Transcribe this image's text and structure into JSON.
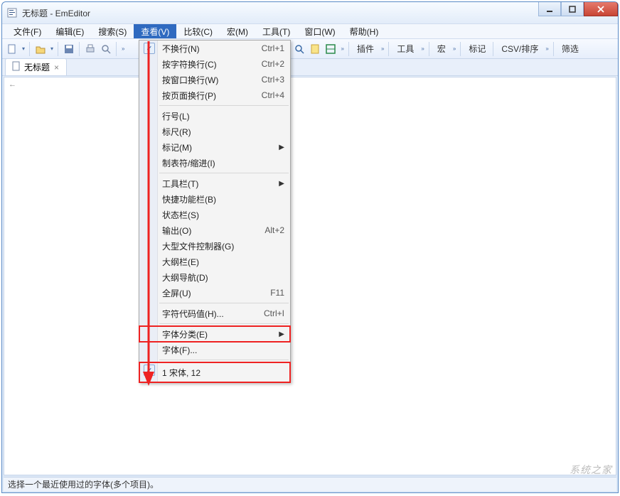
{
  "window": {
    "title": "无标题 - EmEditor"
  },
  "menubar": {
    "items": [
      {
        "label": "文件(F)"
      },
      {
        "label": "编辑(E)"
      },
      {
        "label": "搜索(S)"
      },
      {
        "label": "查看(V)",
        "active": true
      },
      {
        "label": "比较(C)"
      },
      {
        "label": "宏(M)"
      },
      {
        "label": "工具(T)"
      },
      {
        "label": "窗口(W)"
      },
      {
        "label": "帮助(H)"
      }
    ]
  },
  "toolbar": {
    "groups": [
      "插件",
      "工具",
      "宏",
      "标记",
      "CSV/排序",
      "筛选"
    ]
  },
  "tabs": {
    "items": [
      {
        "label": "无标题"
      }
    ]
  },
  "dropdown": {
    "sections": [
      [
        {
          "label": "不换行(N)",
          "shortcut": "Ctrl+1",
          "checked": true
        },
        {
          "label": "按字符换行(C)",
          "shortcut": "Ctrl+2"
        },
        {
          "label": "按窗口换行(W)",
          "shortcut": "Ctrl+3"
        },
        {
          "label": "按页面换行(P)",
          "shortcut": "Ctrl+4"
        }
      ],
      [
        {
          "label": "行号(L)"
        },
        {
          "label": "标尺(R)"
        },
        {
          "label": "标记(M)",
          "submenu": true
        },
        {
          "label": "制表符/缩进(I)"
        }
      ],
      [
        {
          "label": "工具栏(T)",
          "submenu": true
        },
        {
          "label": "快捷功能栏(B)"
        },
        {
          "label": "状态栏(S)"
        },
        {
          "label": "输出(O)",
          "shortcut": "Alt+2"
        },
        {
          "label": "大型文件控制器(G)"
        },
        {
          "label": "大纲栏(E)"
        },
        {
          "label": "大纲导航(D)"
        },
        {
          "label": "全屏(U)",
          "shortcut": "F11"
        }
      ],
      [
        {
          "label": "字符代码值(H)...",
          "shortcut": "Ctrl+I"
        }
      ],
      [
        {
          "label": "字体分类(E)",
          "submenu": true,
          "highlight": "font"
        },
        {
          "label": "字体(F)..."
        }
      ],
      [
        {
          "label": "1 宋体, 12",
          "checked": true,
          "highlight": "recent"
        }
      ]
    ]
  },
  "statusbar": {
    "text": "选择一个最近使用过的字体(多个项目)。"
  },
  "watermark": "系统之家",
  "cursor_hint": "←"
}
